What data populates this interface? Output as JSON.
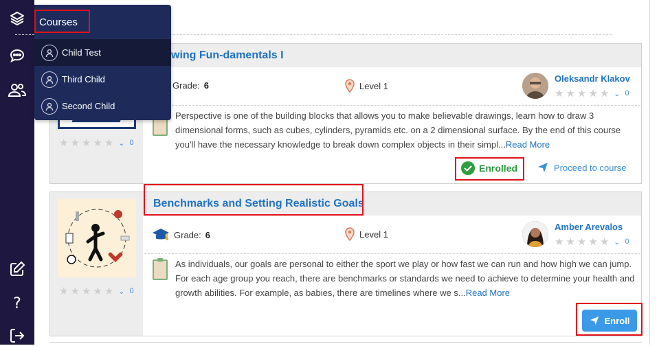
{
  "sidebar": {
    "icons": [
      "layers-icon",
      "chat-icon",
      "users-icon",
      "edit-icon",
      "help-icon",
      "logout-icon"
    ]
  },
  "popup": {
    "title": "Courses",
    "items": [
      {
        "label": "Child Test"
      },
      {
        "label": "Third Child"
      },
      {
        "label": "Second Child"
      }
    ]
  },
  "courses": [
    {
      "title": "wing Fun-damentals I",
      "grade_label": "Grade:",
      "grade_value": "6",
      "level": "Level 1",
      "instructor": "Oleksandr Klakov",
      "rating_count": "0",
      "thumb_rating_count": "0",
      "description": "Perspective is one of the building blocks that allows you to make believable drawings, learn how to draw 3 dimensional forms, such as cubes, cylinders, pyramids etc. on a 2 dimensional surface. By the end of this course you'll have the necessary knowledge to break down complex objects in their simpl...",
      "read_more": "Read More",
      "status": "Enrolled",
      "action": "Proceed to course"
    },
    {
      "title": "Benchmarks and Setting Realistic Goals",
      "grade_label": "Grade:",
      "grade_value": "6",
      "level": "Level 1",
      "instructor": "Amber Arevalos",
      "rating_count": "0",
      "thumb_rating_count": "0",
      "description": "As individuals, our goals are personal to either the sport we play or how fast we can run and how high we can jump. For each age group you reach, there are benchmarks or standards we need to achieve to determine your health and growth abilities. For example, as babies, there are timelines where we s...",
      "read_more": "Read More",
      "action": "Enroll"
    }
  ],
  "colors": {
    "sidebar_bg": "#1e1840",
    "popup_bg": "#1e2b5a",
    "link": "#1f73c4",
    "enrolled": "#2e9e3e",
    "enroll_button": "#3a9ae8",
    "highlight": "#e0101a"
  }
}
